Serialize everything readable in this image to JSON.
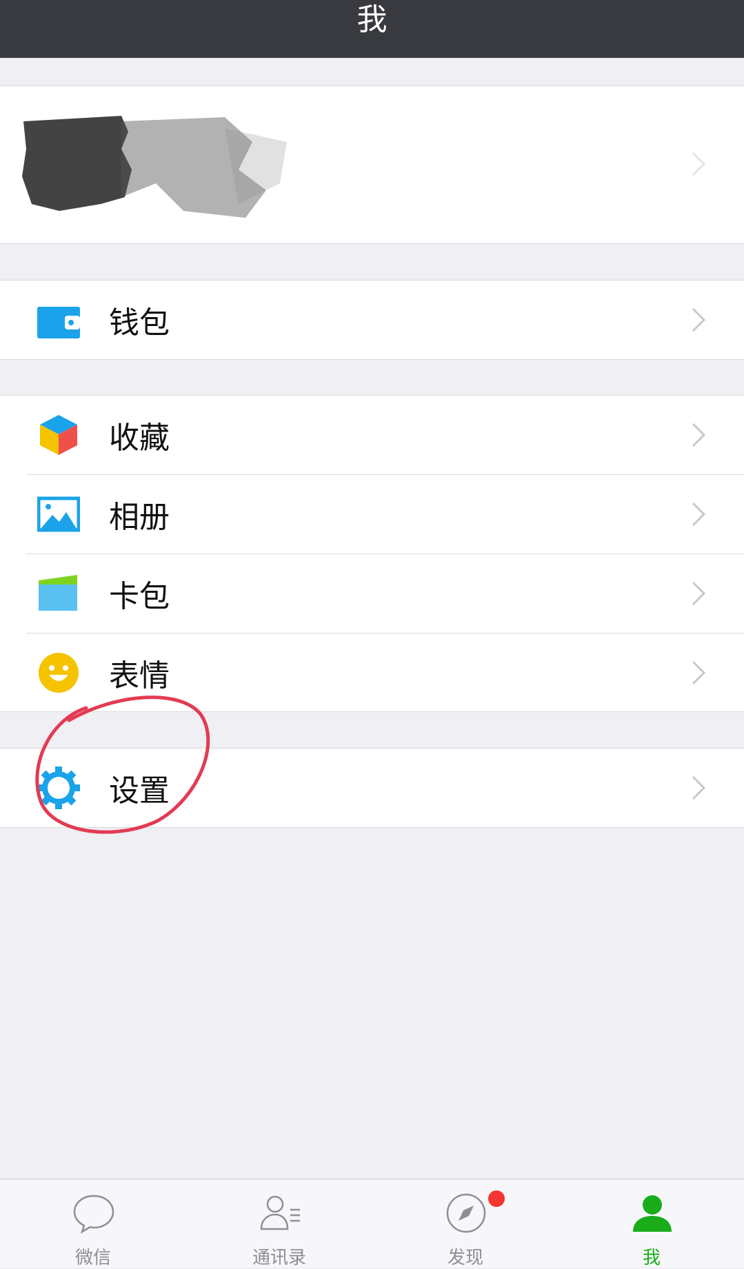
{
  "header": {
    "title": "我"
  },
  "menu": {
    "wallet": "钱包",
    "favorites": "收藏",
    "album": "相册",
    "cards": "卡包",
    "stickers": "表情",
    "settings": "设置"
  },
  "tabbar": {
    "tabs": [
      {
        "label": "微信",
        "icon": "chat-bubble-icon"
      },
      {
        "label": "通讯录",
        "icon": "contacts-icon"
      },
      {
        "label": "发现",
        "icon": "compass-icon",
        "badge": true
      },
      {
        "label": "我",
        "icon": "person-icon",
        "active": true
      }
    ]
  },
  "colors": {
    "header_bg": "#393a3f",
    "page_bg": "#efeff4",
    "active_tab": "#1aad19",
    "icon_blue": "#1aa3ea",
    "badge_red": "#f43530",
    "annotation_red": "#e23b52"
  }
}
